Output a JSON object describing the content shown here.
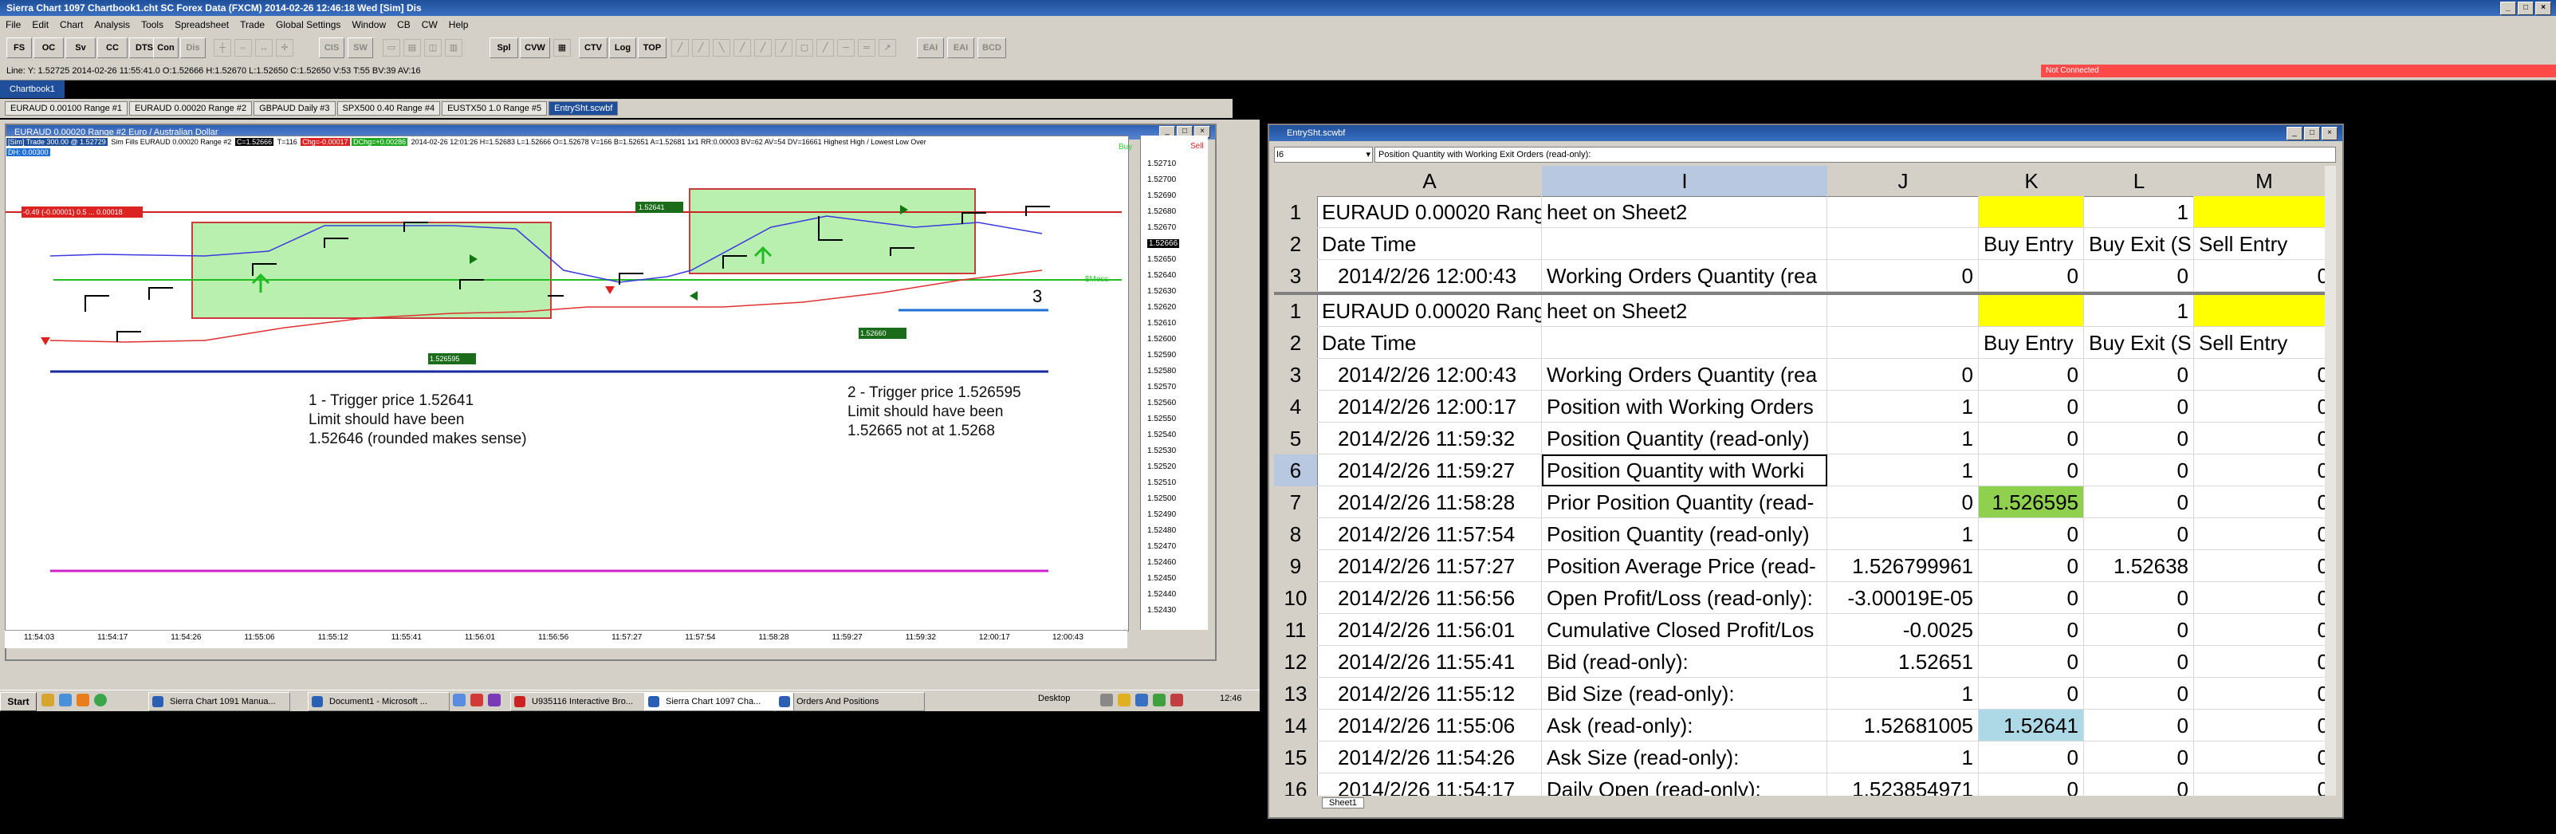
{
  "window": {
    "title": "Sierra Chart 1097 Chartbook1.cht  SC Forex Data (FXCM) 2014-02-26  12:46:18 Wed [Sim]  Dis"
  },
  "menu": [
    "File",
    "Edit",
    "Chart",
    "Analysis",
    "Tools",
    "Spreadsheet",
    "Trade",
    "Global Settings",
    "Window",
    "CB",
    "CW",
    "Help"
  ],
  "toolbar": [
    "FS",
    "OC",
    "Sv",
    "CC",
    "DTS",
    "Con",
    "Dis",
    "CIS",
    "SW",
    "Spl",
    "CVW",
    "CTV",
    "Log",
    "TOP",
    "EAI",
    "EAI",
    "BCD"
  ],
  "status": {
    "line": "Line: Y: 1.52725  2014-02-26  11:55:41.0  O:1.52666  H:1.52670  L:1.52650  C:1.52650  V:53  T:55  BV:39  AV:16",
    "not_connected": "Not Connected"
  },
  "chartbook_tab": "Chartbook1",
  "chart_tabs": [
    "EURAUD  0.00100 Range  #1",
    "EURAUD  0.00020 Range  #2",
    "GBPAUD  Daily  #3",
    "SPX500  0.40 Range  #4",
    "EUSTX50  1.0 Range  #5",
    "EntrySht.scwbf"
  ],
  "chart": {
    "caption": "EURAUD  0.00020 Range  #2  Euro / Australian Dollar",
    "info_sim": "[Sim]  Trade  300.00 @ 1.52729",
    "info_main": "Sim Fills  EURAUD  0.00020 Range  #2",
    "info_c": "C=1.52666",
    "info_t": "T=116",
    "info_chg": "Chg=-0.00017",
    "info_dchg": "DChg=+0.00286",
    "info_rest": "2014-02-26  12:01:26  H=1.52683  L=1.52666  O=1.52678  V=166  B=1.52651  A=1.52681  1x1  RR:0.00003  BV=62  AV=54  DV=16661   Highest High / Lowest Low Over",
    "info_dh": "DH: 0.00300",
    "buy_label": "Buy",
    "sell_label": "Sell",
    "side_label": "$Mess",
    "label_red": "-0.49 (-0.00001) 0.5 ... 0.00018",
    "label_g1": "1.52641",
    "label_g2": "1.526595",
    "label_g3": "1.52660",
    "label_three": "3",
    "annot1": [
      "1 - Trigger price 1.52641",
      "Limit should have been",
      "1.52646 (rounded makes sense)"
    ],
    "annot2": [
      "2 - Trigger price 1.526595",
      "Limit should have been",
      "1.52665 not at 1.5268"
    ],
    "yticks": [
      "1.52710",
      "1.52700",
      "1.52690",
      "1.52680",
      "1.52670",
      "1.52666",
      "1.52650",
      "1.52640",
      "1.52630",
      "1.52620",
      "1.52610",
      "1.52600",
      "1.52590",
      "1.52580",
      "1.52570",
      "1.52560",
      "1.52550",
      "1.52540",
      "1.52530",
      "1.52520",
      "1.52510",
      "1.52500",
      "1.52490",
      "1.52480",
      "1.52470",
      "1.52460",
      "1.52450",
      "1.52440",
      "1.52430"
    ],
    "xticks": [
      "11:54:03",
      "11:54:17",
      "11:54:26",
      "11:55:06",
      "11:55:12",
      "11:55:41",
      "11:56:01",
      "11:56:56",
      "11:57:27",
      "11:57:54",
      "11:58:28",
      "11:59:27",
      "11:59:32",
      "12:00:17",
      "12:00:43"
    ]
  },
  "taskbar": {
    "start": "Start",
    "tasks": [
      "Sierra Chart 1091 Manua...",
      "Document1 - Microsoft ...",
      "U935116 Interactive Bro...",
      "Sierra Chart 1097 Cha...",
      "Orders And Positions"
    ],
    "desktop": "Desktop",
    "clock": "12:46"
  },
  "sheet": {
    "caption": "EntrySht.scwbf",
    "cell_ref": "I6",
    "formula": "Position Quantity with Working Exit Orders (read-only):",
    "columns": [
      "A",
      "I",
      "J",
      "K",
      "L",
      "M"
    ],
    "top_rows": [
      [
        "1",
        "EURAUD  0.00020 Range #2",
        "heet on Sheet2",
        "",
        "",
        "1",
        ""
      ],
      [
        "2",
        "Date Time",
        "",
        "",
        "Buy Entry",
        "Buy Exit (S",
        "Sell Entry",
        "S"
      ],
      [
        "3",
        "2014/2/26 12:00:43",
        "Working Orders Quantity (rea",
        "0",
        "0",
        "0",
        "0"
      ]
    ],
    "rows": [
      [
        "1",
        "EURAUD  0.00020 Range #2",
        "heet on Sheet2",
        "",
        "",
        "1",
        ""
      ],
      [
        "2",
        "Date Time",
        "",
        "",
        "Buy Entry",
        "Buy Exit (S",
        "Sell Entry"
      ],
      [
        "3",
        "2014/2/26 12:00:43",
        "Working Orders Quantity (rea",
        "0",
        "0",
        "0",
        "0"
      ],
      [
        "4",
        "2014/2/26 12:00:17",
        "Position with Working Orders",
        "1",
        "0",
        "0",
        "0"
      ],
      [
        "5",
        "2014/2/26 11:59:32",
        "Position Quantity (read-only)",
        "1",
        "0",
        "0",
        "0"
      ],
      [
        "6",
        "2014/2/26 11:59:27",
        "Position Quantity with Worki",
        "1",
        "0",
        "0",
        "0"
      ],
      [
        "7",
        "2014/2/26 11:58:28",
        "Prior Position Quantity (read-",
        "0",
        "1.526595",
        "0",
        "0"
      ],
      [
        "8",
        "2014/2/26 11:57:54",
        "Position Quantity (read-only)",
        "1",
        "0",
        "0",
        "0"
      ],
      [
        "9",
        "2014/2/26 11:57:27",
        "Position Average Price (read-",
        "1.526799961",
        "0",
        "1.52638",
        "0"
      ],
      [
        "10",
        "2014/2/26 11:56:56",
        "Open Profit/Loss (read-only):",
        "-3.00019E-05",
        "0",
        "0",
        "0"
      ],
      [
        "11",
        "2014/2/26 11:56:01",
        "Cumulative Closed Profit/Los",
        "-0.0025",
        "0",
        "0",
        "0"
      ],
      [
        "12",
        "2014/2/26 11:55:41",
        "Bid (read-only):",
        "1.52651",
        "0",
        "0",
        "0"
      ],
      [
        "13",
        "2014/2/26 11:55:12",
        "Bid Size (read-only):",
        "1",
        "0",
        "0",
        "0"
      ],
      [
        "14",
        "2014/2/26 11:55:06",
        "Ask (read-only):",
        "1.52681005",
        "1.52641",
        "0",
        "0"
      ],
      [
        "15",
        "2014/2/26 11:54:26",
        "Ask Size (read-only):",
        "1",
        "0",
        "0",
        "0"
      ],
      [
        "16",
        "2014/2/26 11:54:17",
        "Daily Open (read-only):",
        "1.523854971",
        "0",
        "0",
        "0"
      ]
    ],
    "sheet_tab": "Sheet1"
  },
  "colors": {
    "title_blue": "#1f4f9a",
    "chrome": "#d4d0c8",
    "highlight_yellow": "#ffff00",
    "highlight_green": "#8fd14f",
    "highlight_blue": "#add8e6",
    "not_connected_red": "#ff4a4a"
  }
}
